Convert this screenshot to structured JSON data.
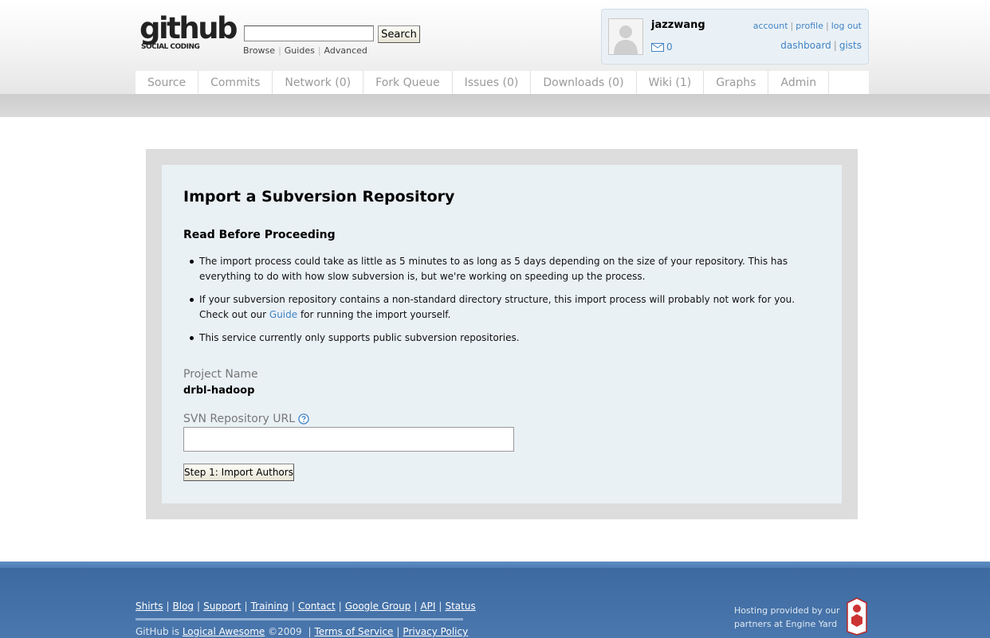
{
  "header": {
    "logo_word": "github",
    "logo_tag": "SOCIAL CODING",
    "search_button": "Search",
    "search_links": [
      "Browse",
      "Guides",
      "Advanced"
    ]
  },
  "user": {
    "name": "jazzwang",
    "messages": "0",
    "links_top": [
      "account",
      "profile",
      "log out"
    ],
    "links_bottom": [
      "dashboard",
      "gists"
    ]
  },
  "tabs": [
    "Source",
    "Commits",
    "Network (0)",
    "Fork Queue",
    "Issues (0)",
    "Downloads (0)",
    "Wiki (1)",
    "Graphs",
    "Admin"
  ],
  "main": {
    "title": "Import a Subversion Repository",
    "subtitle": "Read Before Proceeding",
    "bullet1": "The import process could take as little as 5 minutes to as long as 5 days depending on the size of your repository. This has everything to do with how slow subversion is, but we're working on speeding up the process.",
    "bullet2_pre": "If your subversion repository contains a non-standard directory structure, this import process will probably not work for you. Check out our ",
    "bullet2_link": "Guide",
    "bullet2_post": " for running the import yourself.",
    "bullet3": "This service currently only supports public subversion repositories.",
    "project_label": "Project Name",
    "project_value": "drbl-hadoop",
    "svn_label": "SVN Repository URL",
    "import_button": "Step 1: Import Authors"
  },
  "footer": {
    "links": [
      "Shirts",
      "Blog",
      "Support",
      "Training",
      "Contact",
      "Google Group",
      "API",
      "Status"
    ],
    "copy_pre": "GitHub is ",
    "copy_link": "Logical Awesome",
    "copy_year": " ©2009 ",
    "copy_links": [
      "Terms of Service",
      "Privacy Policy"
    ],
    "hosting_line1": "Hosting provided by our",
    "hosting_line2": "partners at Engine Yard",
    "ey_logo_text": "Engine Yard"
  },
  "colors": {
    "link": "#4183c4",
    "footer_blue": "#4a77ad",
    "panel_bg": "#eaf1f5"
  }
}
